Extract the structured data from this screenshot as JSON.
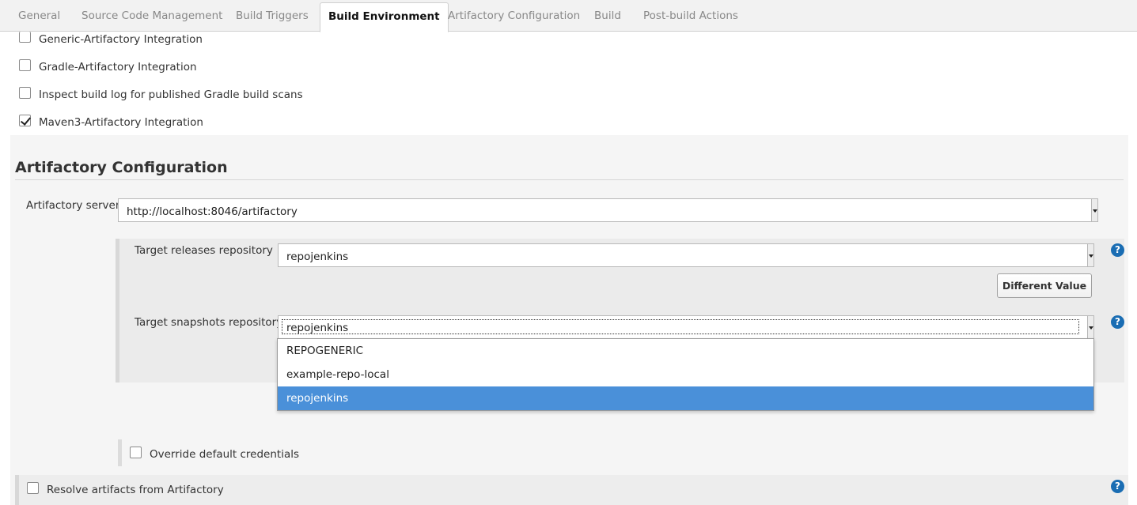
{
  "tabs": [
    {
      "label": "General"
    },
    {
      "label": "Source Code Management"
    },
    {
      "label": "Build Triggers"
    },
    {
      "label": "Build Environment",
      "active": true
    },
    {
      "label": "Artifactory Configuration"
    },
    {
      "label": "Build"
    },
    {
      "label": "Post-build Actions"
    }
  ],
  "build_env": {
    "options": [
      {
        "label": "Generic-Artifactory Integration",
        "checked": false
      },
      {
        "label": "Gradle-Artifactory Integration",
        "checked": false
      },
      {
        "label": "Inspect build log for published Gradle build scans",
        "checked": false
      },
      {
        "label": "Maven3-Artifactory Integration",
        "checked": true
      }
    ]
  },
  "artifactory": {
    "title": "Artifactory Configuration",
    "server_label": "Artifactory server",
    "server_value": "http://localhost:8046/artifactory",
    "releases_label": "Target releases repository",
    "releases_value": "repojenkins",
    "different_value_button": "Different Value",
    "snapshots_label": "Target snapshots repository",
    "snapshots_value": "repojenkins",
    "snapshots_options": [
      "REPOGENERIC",
      "example-repo-local",
      "repojenkins"
    ],
    "snapshots_selected": "repojenkins",
    "override_credentials_label": "Override default credentials",
    "override_credentials_checked": false,
    "resolve_label": "Resolve artifacts from Artifactory",
    "resolve_checked": false
  },
  "icons": {
    "help": "help-icon",
    "dropdown": "dropdown-arrow-icon",
    "checkmark": "checkmark-icon"
  },
  "help_glyph": "?",
  "colors": {
    "selected_option": "#4a90d9",
    "help_icon": "#1a6db3",
    "tab_bar": "#f2f2f2",
    "panel": "#f0f0f0"
  }
}
